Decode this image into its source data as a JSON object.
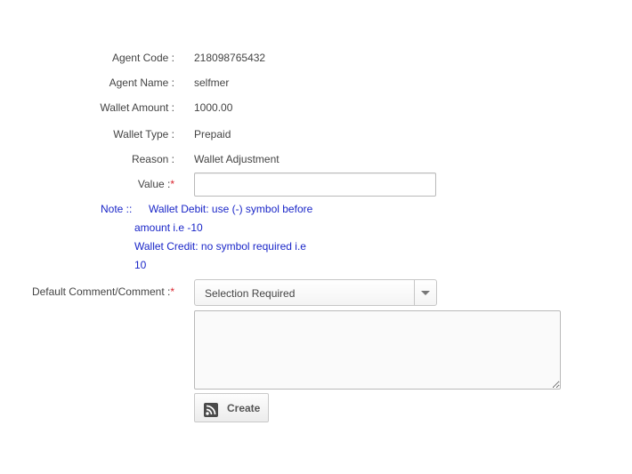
{
  "form": {
    "agent_code": {
      "label": "Agent Code :",
      "value": "218098765432"
    },
    "agent_name": {
      "label": "Agent Name :",
      "value": "selfmer"
    },
    "wallet_amount": {
      "label": "Wallet Amount :",
      "value": "1000.00"
    },
    "wallet_type": {
      "label": "Wallet Type :",
      "value": "Prepaid"
    },
    "reason": {
      "label": "Reason :",
      "value": "Wallet Adjustment"
    },
    "value_field": {
      "label": "Value :",
      "required_mark": "*",
      "value": ""
    },
    "note": {
      "label": "Note ::",
      "debit_line1": "Wallet Debit: use (-) symbol before",
      "debit_line2": "amount i.e -10",
      "credit_line1": "Wallet Credit: no symbol required i.e",
      "credit_line2": "10"
    },
    "comment": {
      "label": "Default Comment/Comment :",
      "required_mark": "*",
      "select_value": "Selection Required",
      "text_value": ""
    },
    "create_button": {
      "label": "Create",
      "icon": "rss-feed-icon"
    }
  },
  "colors": {
    "required": "#d9232d",
    "note_text": "#1a26c8",
    "label_text": "#444444"
  }
}
